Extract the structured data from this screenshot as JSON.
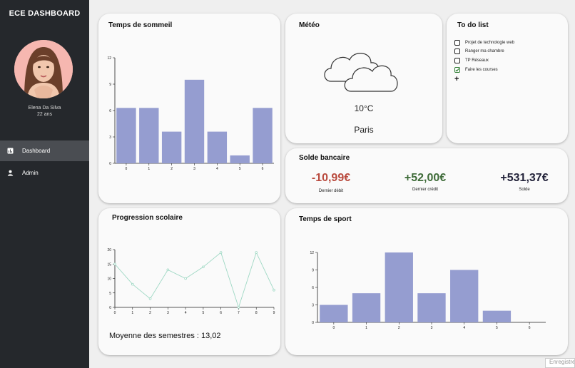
{
  "sidebar": {
    "brand": "ECE DASHBOARD",
    "user": {
      "name": "Elena Da Silva",
      "age": "22 ans"
    },
    "nav": [
      {
        "label": "Dashboard",
        "icon": "dashboard-icon",
        "active": true
      },
      {
        "label": "Admin",
        "icon": "person-icon",
        "active": false
      }
    ]
  },
  "sleep": {
    "title": "Temps de sommeil",
    "chart_data": {
      "type": "bar",
      "categories": [
        "0",
        "1",
        "2",
        "3",
        "4",
        "5",
        "6"
      ],
      "values": [
        6.3,
        6.3,
        3.6,
        9.5,
        3.6,
        0.9,
        6.3
      ],
      "yticks": [
        "0",
        "3",
        "6",
        "9",
        "12"
      ],
      "ylim": [
        0,
        12
      ],
      "color": "#959dd0"
    }
  },
  "weather": {
    "title": "Météo",
    "icon": "cloud-icon",
    "temp": "10°C",
    "city": "Paris"
  },
  "todo": {
    "title": "To do list",
    "items": [
      {
        "label": "Projet de technologie web",
        "checked": false
      },
      {
        "label": "Ranger ma chambre",
        "checked": false
      },
      {
        "label": "TP Réseaux",
        "checked": false
      },
      {
        "label": "Faire les courses",
        "checked": true
      }
    ],
    "add_label": "+"
  },
  "bank": {
    "title": "Solde bancaire",
    "debit": {
      "amount": "-10,99€",
      "label": "Dernier débit",
      "color": "#b94a3e"
    },
    "credit": {
      "amount": "+52,00€",
      "label": "Dernier crédit",
      "color": "#3e6b38"
    },
    "balance": {
      "amount": "+531,37€",
      "label": "Solde",
      "color": "#23233a"
    }
  },
  "grades": {
    "title": "Progression scolaire",
    "average_text": "Moyenne des semestres : 13,02",
    "chart_data": {
      "type": "line",
      "x": [
        0,
        1,
        2,
        3,
        4,
        5,
        6,
        7,
        8,
        9
      ],
      "values": [
        15,
        8,
        3,
        13,
        10,
        14,
        19,
        0,
        19,
        6
      ],
      "yticks": [
        "0",
        "5",
        "10",
        "15",
        "20"
      ],
      "ylim": [
        0,
        20
      ],
      "color": "#9fd8c4"
    }
  },
  "sport": {
    "title": "Temps de sport",
    "chart_data": {
      "type": "bar",
      "categories": [
        "0",
        "1",
        "2",
        "3",
        "4",
        "5",
        "6"
      ],
      "values": [
        3,
        5,
        12,
        5,
        9,
        2,
        0
      ],
      "yticks": [
        "0",
        "3",
        "6",
        "9",
        "12"
      ],
      "ylim": [
        0,
        12
      ],
      "color": "#959dd0"
    }
  },
  "footer": {
    "save_tab": "Enregistrer"
  }
}
